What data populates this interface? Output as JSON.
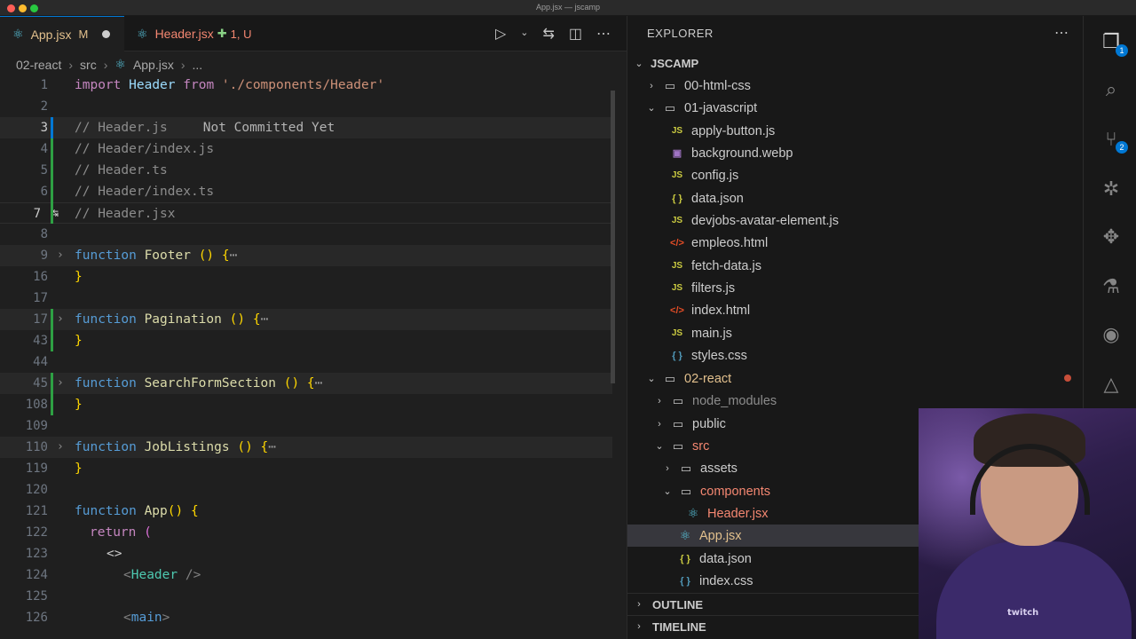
{
  "window": {
    "title": "App.jsx — jscamp"
  },
  "tabs": [
    {
      "label": "App.jsx",
      "badge": "M"
    },
    {
      "label": "Header.jsx",
      "badge": "1, U"
    }
  ],
  "breadcrumb": {
    "folder1": "02-react",
    "folder2": "src",
    "file": "App.jsx",
    "more": "..."
  },
  "editor": {
    "blame": "Not Committed Yet",
    "line_numbers": [
      "1",
      "2",
      "3",
      "4",
      "5",
      "6",
      "7",
      "8",
      "9",
      "16",
      "17",
      "43",
      "44",
      "45",
      "108",
      "109",
      "110",
      "119",
      "120",
      "121",
      "122",
      "123",
      "124",
      "125",
      "126"
    ],
    "comments": {
      "c3": "// Header.js",
      "c4": "// Header/index.js",
      "c5": "// Header.ts",
      "c6": "// Header/index.ts",
      "c7": "// Header.jsx"
    },
    "import_line": {
      "kw1": "import",
      "name": "Header",
      "kw2": "from",
      "path": "'./components/Header'"
    },
    "functions": [
      {
        "name": "Footer"
      },
      {
        "name": "Pagination"
      },
      {
        "name": "SearchFormSection"
      },
      {
        "name": "JobListings"
      },
      {
        "name": "App"
      }
    ],
    "keywords": {
      "function": "function",
      "return": "return"
    },
    "jsx": {
      "fragment": "<>",
      "header_tag": "Header",
      "main_tag": "main"
    }
  },
  "explorer": {
    "title": "EXPLORER",
    "root": "JSCAMP",
    "items": [
      {
        "label": "00-html-css",
        "type": "folder"
      },
      {
        "label": "01-javascript",
        "type": "folder"
      },
      {
        "label": "apply-button.js",
        "type": "js"
      },
      {
        "label": "background.webp",
        "type": "img"
      },
      {
        "label": "config.js",
        "type": "js"
      },
      {
        "label": "data.json",
        "type": "json"
      },
      {
        "label": "devjobs-avatar-element.js",
        "type": "js"
      },
      {
        "label": "empleos.html",
        "type": "html"
      },
      {
        "label": "fetch-data.js",
        "type": "js"
      },
      {
        "label": "filters.js",
        "type": "js"
      },
      {
        "label": "index.html",
        "type": "html"
      },
      {
        "label": "main.js",
        "type": "js"
      },
      {
        "label": "styles.css",
        "type": "css"
      },
      {
        "label": "02-react",
        "type": "folder"
      },
      {
        "label": "node_modules",
        "type": "folder"
      },
      {
        "label": "public",
        "type": "folder"
      },
      {
        "label": "src",
        "type": "folder"
      },
      {
        "label": "assets",
        "type": "folder"
      },
      {
        "label": "components",
        "type": "folder"
      },
      {
        "label": "Header.jsx",
        "type": "react"
      },
      {
        "label": "App.jsx",
        "type": "react"
      },
      {
        "label": "data.json",
        "type": "json"
      },
      {
        "label": "index.css",
        "type": "css"
      }
    ],
    "sections": {
      "outline": "OUTLINE",
      "timeline": "TIMELINE"
    },
    "file_icon_text": {
      "js": "JS",
      "json": "{ }",
      "html": "</>"
    }
  },
  "activity": {
    "badges": [
      "1",
      "2"
    ]
  },
  "webcam": {
    "logo": "twitch"
  }
}
